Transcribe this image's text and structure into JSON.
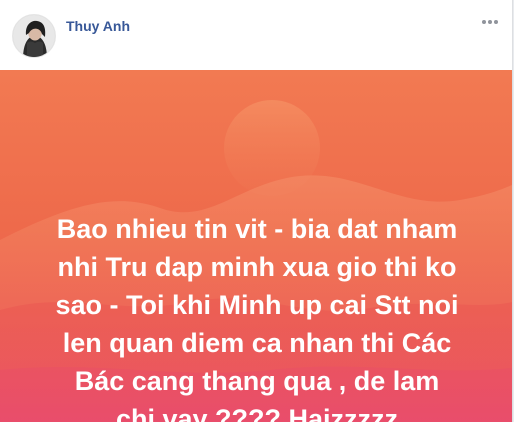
{
  "post": {
    "author": {
      "name": "Thuy Anh",
      "avatar_icon": "profile-photo"
    },
    "more_icon": "ellipsis-icon",
    "status_text": "Bao nhieu tin vit - bia dat nham\nnhi Tru dap minh xua gio thi ko\nsao - Toi khi Minh up cai Stt noi\nlen quan diem ca nhan thi Các\nBác cang thang qua , de lam\nchi vay ???? Haizzzzz",
    "background_colors": {
      "top": "#f27a52",
      "middle": "#ee6a4b",
      "bottom": "#ea4d6f"
    },
    "author_name_color": "#385898"
  }
}
